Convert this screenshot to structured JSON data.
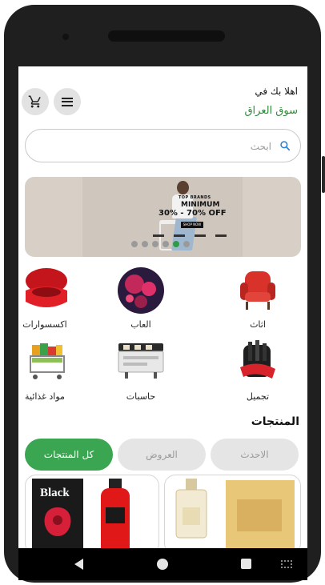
{
  "header": {
    "greeting": "اهلا بك في",
    "app_name": "سوق العراق"
  },
  "search": {
    "placeholder": "ابحث"
  },
  "banner": {
    "brand_line": "TOP BRANDS",
    "headline": "MINIMUM",
    "discount": "30% - 70% OFF",
    "cta": "SHOP NOW",
    "slide_count": 6,
    "active_slide": 4
  },
  "categories": [
    {
      "label": "اثاث",
      "icon": "armchair"
    },
    {
      "label": "العاب",
      "icon": "toy-ball"
    },
    {
      "label": "اكسسوارات",
      "icon": "jewelry-box"
    },
    {
      "label": "تجميل",
      "icon": "makeup-brushes"
    },
    {
      "label": "حاسبات",
      "icon": "computer"
    },
    {
      "label": "مواد غذائية",
      "icon": "grocery-cart"
    }
  ],
  "products_section": {
    "title": "المنتجات",
    "tabs": [
      {
        "label": "الاحدث",
        "selected": false
      },
      {
        "label": "العروض",
        "selected": false
      },
      {
        "label": "كل المنتجات",
        "selected": true
      }
    ]
  },
  "products": [
    {
      "brand_text": "Black",
      "image": "perfume-black"
    },
    {
      "brand_text": "",
      "image": "perfume-gold"
    }
  ],
  "colors": {
    "accent_green": "#3aa651",
    "app_name_green": "#2e8b3a",
    "chip_inactive": "#e5e5e5"
  }
}
